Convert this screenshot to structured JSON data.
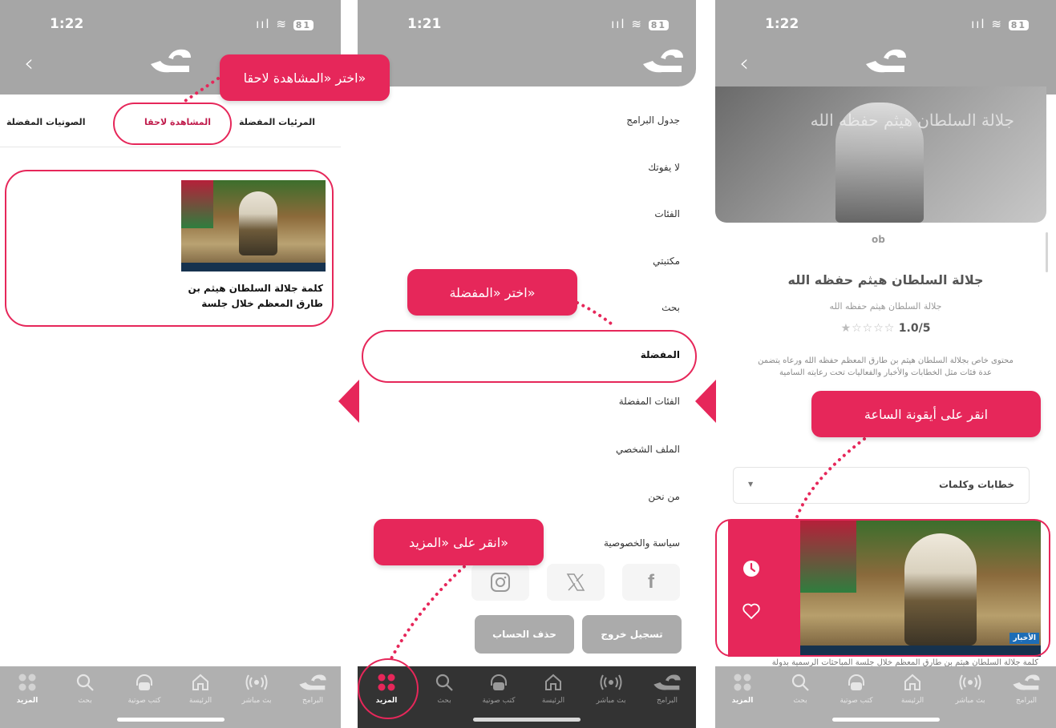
{
  "brand": {
    "accent": "#e6275a",
    "header_gray": "#a8a8a8",
    "dark_nav": "#333333"
  },
  "status": {
    "time_left": "1:22",
    "time_middle": "1:21",
    "time_right": "1:22",
    "battery": "81",
    "signal": "ııl ≋"
  },
  "screen1": {
    "tabs": [
      "المرئيات المفضلة",
      "المشاهدة لاحقا",
      "الصوتيات المفضلة"
    ],
    "card_title": "كلمة جلالة السلطان هيثم بن طارق المعظم خلال جلسة"
  },
  "screen2": {
    "menu": [
      "جدول البرامج",
      "لا يفوتك",
      "الفئات",
      "مكتبتي",
      "بحث",
      "المفضلة",
      "الفئات المفضلة",
      "الملف الشخصي",
      "من نحن",
      "سياسة والخصوصية"
    ],
    "social": [
      "facebook-icon",
      "x-icon",
      "instagram-icon"
    ],
    "logout": "تسجيل خروج",
    "delete_account": "حذف الحساب"
  },
  "screen3": {
    "hero_calligraphy": "جلالة السلطان هيثم حفظه الله",
    "small_logo": "ob",
    "title": "جلالة السلطان هيثم حفظه الله",
    "subtitle": "جلالة السلطان هيثم حفظه الله",
    "rating": "1.0/5",
    "stars": "★☆☆☆☆",
    "desc_line1": "محتوى خاص بجلالة السلطان هيثم بن طارق المعظم حفظه الله ورعاه يتضمن",
    "desc_line2": "عدة فئات مثل الخطابات والأخبار والفعاليات تحت رعايته السامية",
    "dropdown": "خطابات وكلمات",
    "news_badge": "الأخبار",
    "episode_caption": "كلمة جلالة السلطان هيثم بن طارق المعظم خلال جلسة المباحثات الرسمية بدولة"
  },
  "nav": [
    {
      "key": "more",
      "label": "المزيد",
      "icon": "grid-dots-icon"
    },
    {
      "key": "search",
      "label": "بحث",
      "icon": "search-icon"
    },
    {
      "key": "audiobooks",
      "label": "كتب صوتية",
      "icon": "headphones-icon"
    },
    {
      "key": "home",
      "label": "الرئيسة",
      "icon": "home-icon"
    },
    {
      "key": "live",
      "label": "بث مباشر",
      "icon": "broadcast-icon"
    },
    {
      "key": "programs",
      "label": "البرامج",
      "icon": "logo-icon"
    }
  ],
  "callouts": {
    "watch_later": "اختر «المشاهدة لاحقا»",
    "favorites": "اختر «المفضلة»",
    "more": "انقر على «المزيد»",
    "clock": "انقر على أيقونة الساعة"
  }
}
